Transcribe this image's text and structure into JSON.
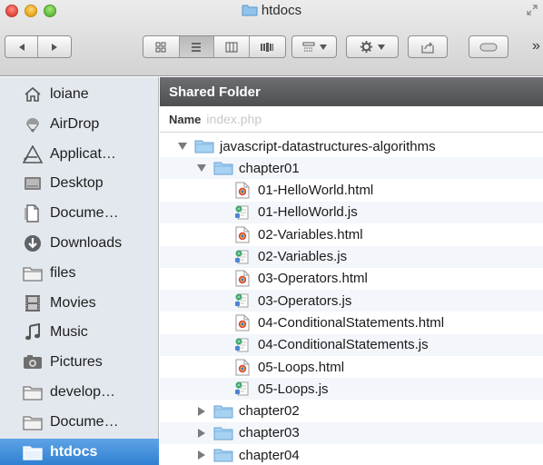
{
  "window": {
    "title": "htdocs"
  },
  "sidebar": {
    "items": [
      {
        "label": "loiane",
        "icon": "home-icon",
        "selected": false
      },
      {
        "label": "AirDrop",
        "icon": "airdrop-icon",
        "selected": false
      },
      {
        "label": "Applicat…",
        "icon": "applications-icon",
        "selected": false
      },
      {
        "label": "Desktop",
        "icon": "desktop-icon",
        "selected": false
      },
      {
        "label": "Docume…",
        "icon": "documents-icon",
        "selected": false
      },
      {
        "label": "Downloads",
        "icon": "downloads-icon",
        "selected": false
      },
      {
        "label": "files",
        "icon": "folder-icon",
        "selected": false
      },
      {
        "label": "Movies",
        "icon": "movies-icon",
        "selected": false
      },
      {
        "label": "Music",
        "icon": "music-icon",
        "selected": false
      },
      {
        "label": "Pictures",
        "icon": "pictures-icon",
        "selected": false
      },
      {
        "label": "develop…",
        "icon": "folder-icon",
        "selected": false
      },
      {
        "label": "Docume…",
        "icon": "folder-icon",
        "selected": false
      },
      {
        "label": "htdocs",
        "icon": "folder-icon",
        "selected": true
      }
    ]
  },
  "content": {
    "banner": "Shared Folder",
    "column_name": "Name",
    "ghost_filename": "index.php",
    "rows": [
      {
        "label": "javascript-datastructures-algorithms",
        "kind": "folder",
        "expanded": true,
        "level": 0
      },
      {
        "label": "chapter01",
        "kind": "folder",
        "expanded": true,
        "level": 1
      },
      {
        "label": "01-HelloWorld.html",
        "kind": "html",
        "level": 2
      },
      {
        "label": "01-HelloWorld.js",
        "kind": "js",
        "level": 2
      },
      {
        "label": "02-Variables.html",
        "kind": "html",
        "level": 2
      },
      {
        "label": "02-Variables.js",
        "kind": "js",
        "level": 2
      },
      {
        "label": "03-Operators.html",
        "kind": "html",
        "level": 2
      },
      {
        "label": "03-Operators.js",
        "kind": "js",
        "level": 2
      },
      {
        "label": "04-ConditionalStatements.html",
        "kind": "html",
        "level": 2
      },
      {
        "label": "04-ConditionalStatements.js",
        "kind": "js",
        "level": 2
      },
      {
        "label": "05-Loops.html",
        "kind": "html",
        "level": 2
      },
      {
        "label": "05-Loops.js",
        "kind": "js",
        "level": 2
      },
      {
        "label": "chapter02",
        "kind": "folder",
        "expanded": false,
        "level": 1
      },
      {
        "label": "chapter03",
        "kind": "folder",
        "expanded": false,
        "level": 1
      },
      {
        "label": "chapter04",
        "kind": "folder",
        "expanded": false,
        "level": 1
      }
    ]
  },
  "colors": {
    "selection": "#3b86d6",
    "sidebar_bg": "#e3e8ee",
    "folder": "#8fc3ea",
    "banner": "#5a5c60"
  }
}
